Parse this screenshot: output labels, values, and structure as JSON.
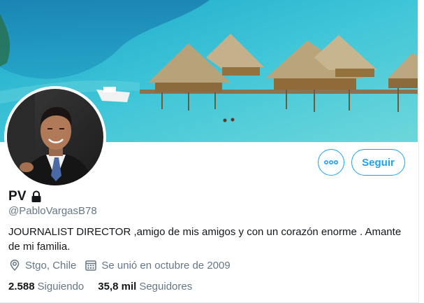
{
  "profile": {
    "display_name": "PV",
    "handle": "@PabloVargasB78",
    "bio": "JOURNALIST DIRECTOR ,amigo de mis amigos y con un corazón enorme . Amante de mi familia.",
    "location": "Stgo, Chile",
    "joined": "Se unió en octubre de 2009",
    "protected_icon": "lock-icon"
  },
  "actions": {
    "follow_label": "Seguir",
    "more_icon": "more-dots-icon"
  },
  "stats": {
    "following_count": "2.588",
    "following_label": "Siguiendo",
    "followers_count": "35,8 mil",
    "followers_label": "Seguidores"
  },
  "meta_icons": {
    "location": "location-pin-icon",
    "joined": "calendar-icon"
  },
  "colors": {
    "accent": "#1da1f2",
    "secondary_text": "#657786",
    "primary_text": "#14171a"
  }
}
